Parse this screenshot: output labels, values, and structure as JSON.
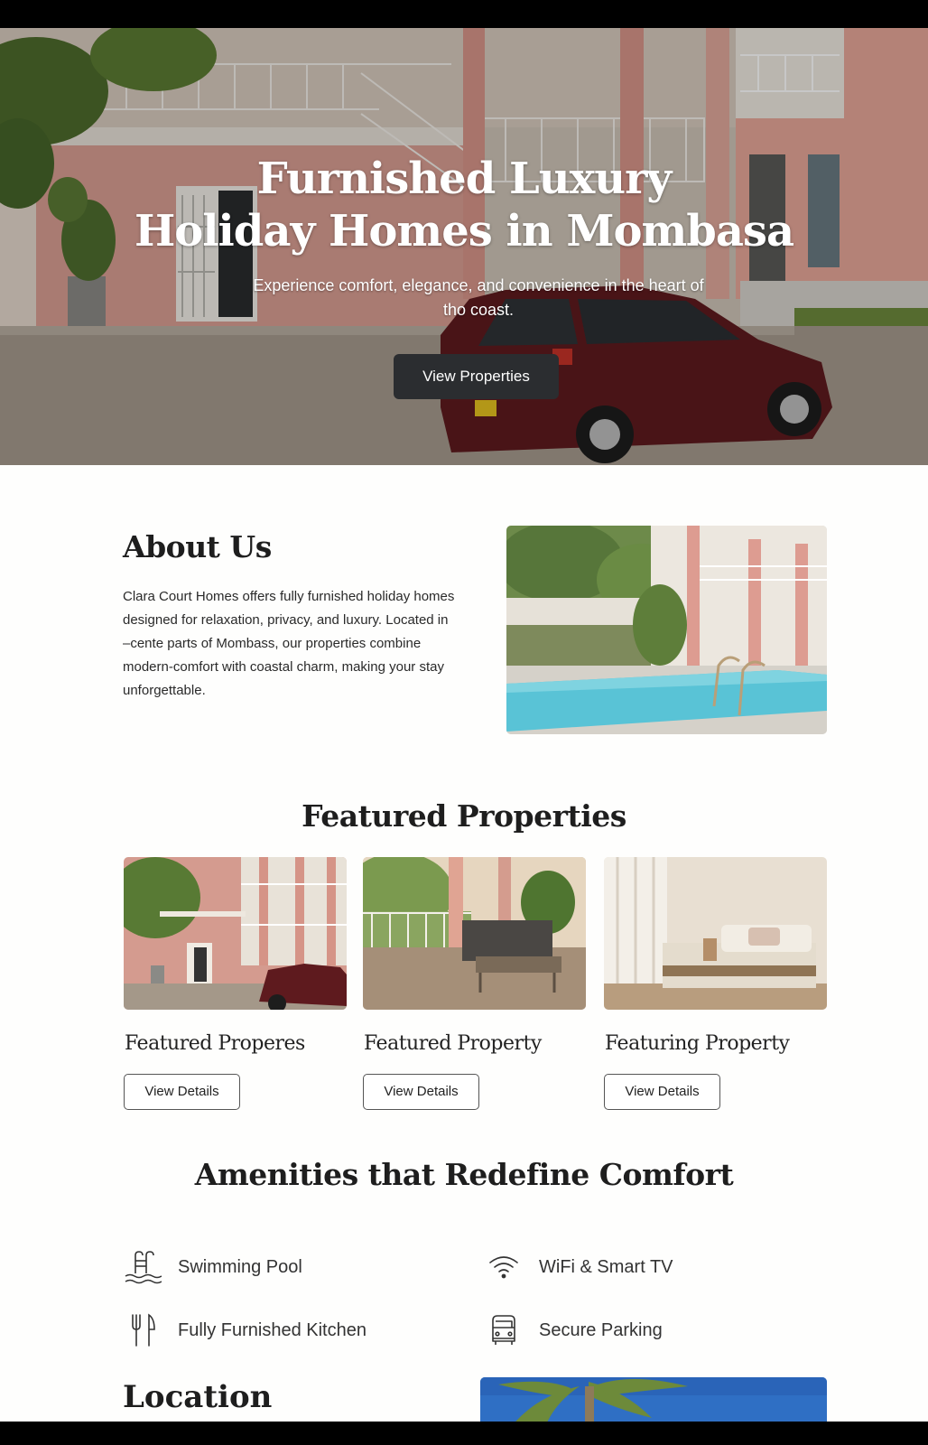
{
  "hero": {
    "title_line1": "Furnished Luxury",
    "title_line2": "Holiday Homes in Mombasa",
    "subtitle": "Experience comfort, elegance, and convenience in the heart of tho coast.",
    "button_label": "View Properties"
  },
  "about": {
    "title": "About Us",
    "text": "Clara Court Homes offers fully furnished holiday homes designed for relaxation, privacy, and luxury. Located in –cente parts of Mombass, our properties combine modern-comfort with coastal charm, making your stay unforgettable."
  },
  "featured": {
    "title": "Featured Properties",
    "cards": [
      {
        "name": "Featured Properes",
        "button": "View Details"
      },
      {
        "name": "Featured Property",
        "button": "View Details"
      },
      {
        "name": "Featuring Property",
        "button": "View Details"
      }
    ]
  },
  "amenities": {
    "title": "Amenities that Redefine Comfort",
    "items": [
      {
        "label": "Swimming Pool",
        "icon": "pool-icon"
      },
      {
        "label": "WiFi & Smart TV",
        "icon": "wifi-icon"
      },
      {
        "label": "Fully Furnished Kitchen",
        "icon": "utensils-icon"
      },
      {
        "label": "Secure Parking",
        "icon": "car-icon"
      }
    ]
  },
  "location": {
    "title": "Location"
  },
  "colors": {
    "building_pink": "#d99e92",
    "pool_blue": "#59c3d6",
    "car_maroon": "#5e1a1e",
    "button_dark": "#2b2d30"
  }
}
